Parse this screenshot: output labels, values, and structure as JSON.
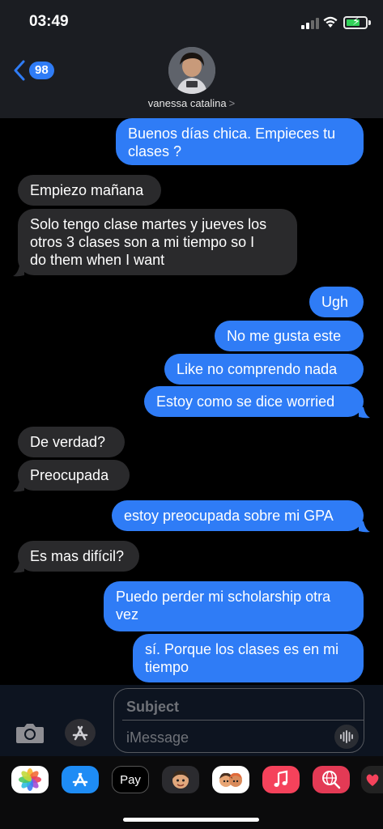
{
  "status_bar": {
    "time": "03:49"
  },
  "header": {
    "back_count": "98",
    "contact_name": "vanessa catalina",
    "contact_chevron": ">"
  },
  "messages": [
    {
      "from": "me",
      "text": "Buenos días chica. Empieces tu\nclases ?"
    },
    {
      "from": "them",
      "text": "Empiezo mañana"
    },
    {
      "from": "them",
      "text": "Solo tengo clase martes y jueves los\notros 3 clases son a mi tiempo so I\ndo them when I want"
    },
    {
      "from": "me",
      "text": "Ugh"
    },
    {
      "from": "me",
      "text": "No me gusta este"
    },
    {
      "from": "me",
      "text": "Like no comprendo nada"
    },
    {
      "from": "me",
      "text": "Estoy como se dice worried"
    },
    {
      "from": "them",
      "text": "De verdad?"
    },
    {
      "from": "them",
      "text": "Preocupada"
    },
    {
      "from": "me",
      "text": "estoy preocupada sobre mi GPA"
    },
    {
      "from": "them",
      "text": "Es mas difícil?"
    },
    {
      "from": "me",
      "text": "Puedo perder mi scholarship otra\nvez"
    },
    {
      "from": "me",
      "text": "sí. Porque los clases es en mi\ntiempo"
    }
  ],
  "compose": {
    "subject_placeholder": "Subject",
    "message_placeholder": "iMessage"
  },
  "apps": [
    {
      "name": "photos-app-icon",
      "label": ""
    },
    {
      "name": "appstore-app-icon",
      "label": ""
    },
    {
      "name": "applepay-app-icon",
      "label": "Pay"
    },
    {
      "name": "memoji-app-icon",
      "label": ""
    },
    {
      "name": "memoji-stickers-app-icon",
      "label": ""
    },
    {
      "name": "music-app-icon",
      "label": ""
    },
    {
      "name": "search-images-app-icon",
      "label": ""
    },
    {
      "name": "digital-touch-app-icon",
      "label": ""
    }
  ],
  "colors": {
    "sent_bubble": "#2f7cf6",
    "received_bubble": "#2a2a2c",
    "background": "#000000",
    "badge": "#2f7cf6"
  }
}
